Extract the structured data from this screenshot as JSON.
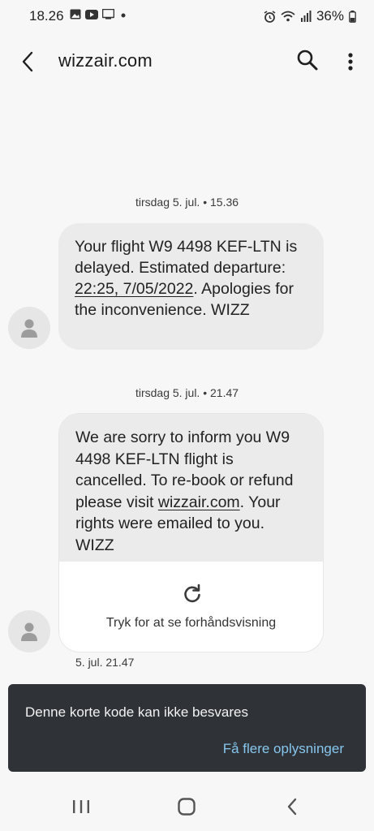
{
  "status_bar": {
    "time": "18.26",
    "battery": "36%",
    "icons": [
      "gallery-icon",
      "youtube-icon",
      "screen-icon",
      "dot-icon",
      "alarm-icon",
      "wifi-icon",
      "signal-icon",
      "battery-icon"
    ]
  },
  "header": {
    "title": "wizzair.com",
    "icons": [
      "back-arrow-icon",
      "search-icon",
      "more-vert-icon"
    ]
  },
  "messages": [
    {
      "timestamp": "tirsdag 5. jul. • 15.36",
      "parts": [
        "Your flight W9 4498 KEF-LTN is delayed. Estimated departure: ",
        "22:25, 7/05/2022",
        ". Apologies for the inconvenience. WIZZ"
      ]
    },
    {
      "timestamp": "tirsdag 5. jul. • 21.47",
      "parts": [
        "We are sorry to inform you W9 4498 KEF-LTN flight is cancelled. To re-book or refund please visit ",
        "wizzair.com",
        ". Your rights were emailed to you. WIZZ"
      ],
      "preview_label": "Tryk for at se forhåndsvisning",
      "sent_time": "5. jul. 21.47"
    }
  ],
  "snackbar": {
    "message": "Denne korte kode kan ikke besvares",
    "action": "Få flere oplysninger"
  },
  "nav": {
    "icons": [
      "recent-apps-icon",
      "home-icon",
      "back-icon"
    ]
  },
  "colors": {
    "bubble": "#ebebeb",
    "snackbar": "#2f3337",
    "snackbar_action": "#86c6ee"
  }
}
